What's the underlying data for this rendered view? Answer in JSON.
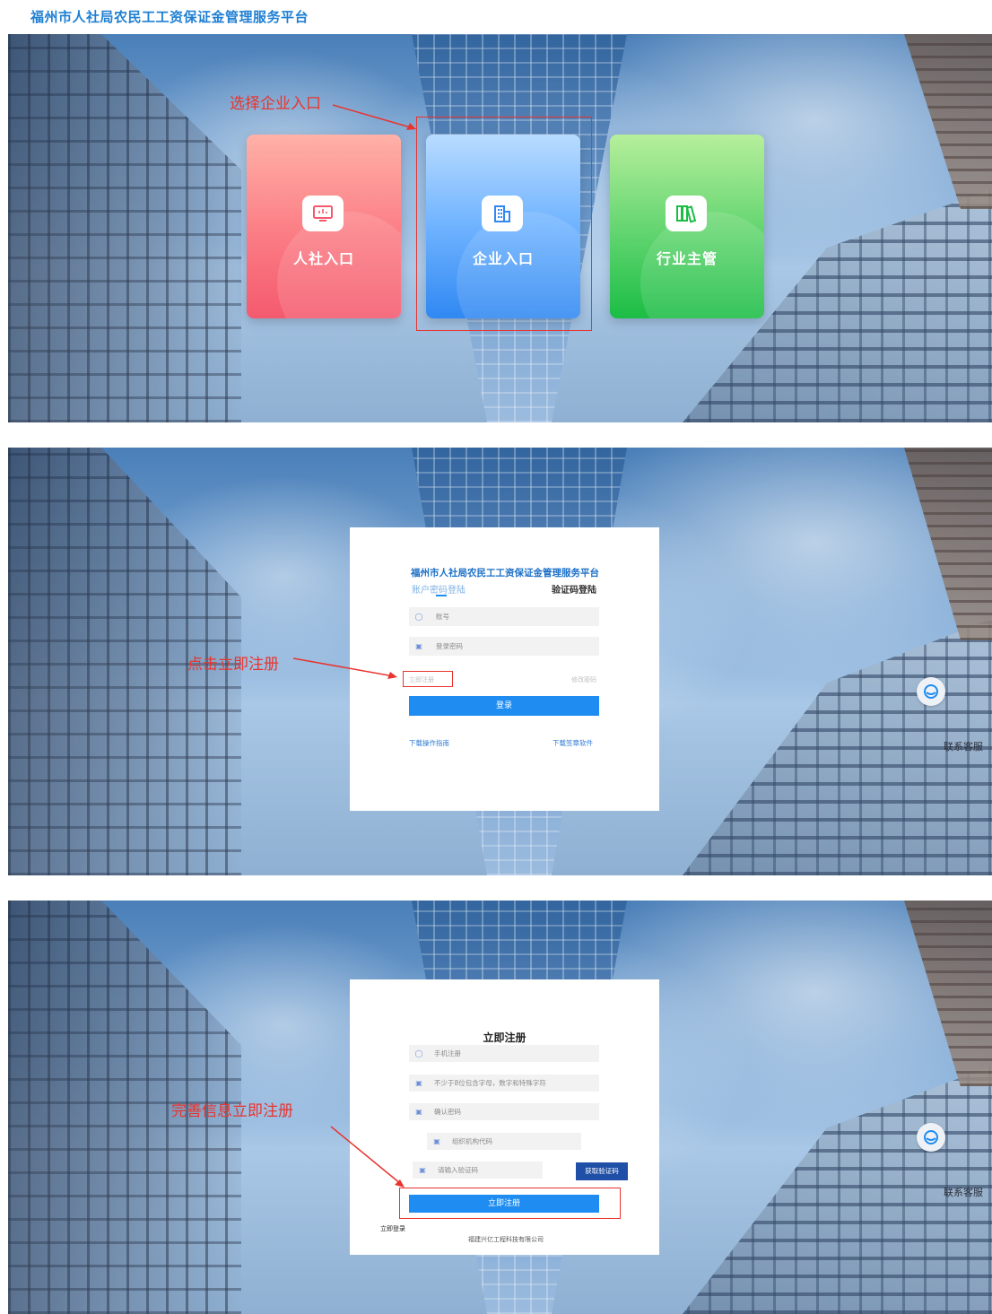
{
  "header": {
    "title": "福州市人社局农民工工资保证金管理服务平台"
  },
  "step1": {
    "annotation": "选择企业入口",
    "cards": [
      {
        "label": "人社入口",
        "icon": "monitor-icon",
        "color": "#f45a6e"
      },
      {
        "label": "企业入口",
        "icon": "building-icon",
        "color": "#3088f2"
      },
      {
        "label": "行业主管",
        "icon": "books-icon",
        "color": "#1bbd45"
      }
    ]
  },
  "step2": {
    "annotation": "点击立即注册",
    "login": {
      "title": "福州市人社局农民工工资保证金管理服务平台",
      "tab_account": "账户密码登陆",
      "tab_code": "验证码登陆",
      "account_placeholder": "账号",
      "password_placeholder": "登录密码",
      "register_link": "立即注册",
      "change_password_link": "修改密码",
      "login_button": "登录",
      "download_guide": "下载操作指南",
      "download_sign": "下载签章软件"
    },
    "support_label": "联系客服"
  },
  "step3": {
    "annotation": "完善信息立即注册",
    "register": {
      "title": "立即注册",
      "phone_placeholder": "手机注册",
      "password_placeholder": "不少于8位包含字母，数字和特殊字符",
      "confirm_placeholder": "确认密码",
      "org_code_placeholder": "组织机构代码",
      "verify_placeholder": "请输入验证码",
      "get_code_button": "获取验证码",
      "submit_button": "立即注册",
      "login_link": "立即登录",
      "company": "福建兴亿工程科技有限公司"
    },
    "support_label": "联系客服"
  },
  "colors": {
    "primary": "#1e8cf0",
    "annotation": "#e8342e",
    "title": "#1f7fd3"
  }
}
